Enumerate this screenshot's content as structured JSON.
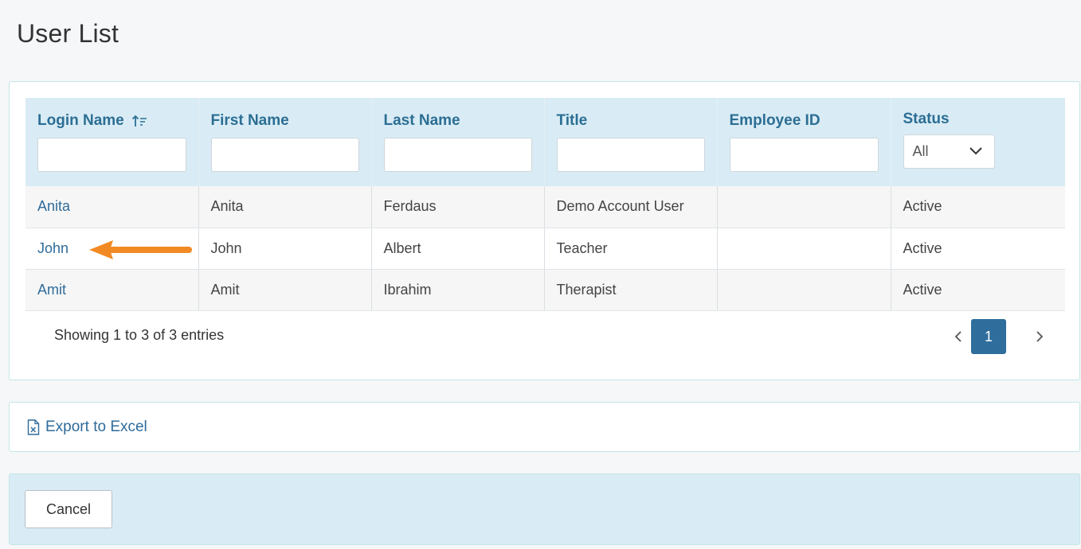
{
  "page": {
    "title": "User List"
  },
  "table": {
    "columns": [
      "Login Name",
      "First Name",
      "Last Name",
      "Title",
      "Employee ID",
      "Status"
    ],
    "status_filter": {
      "selected": "All"
    },
    "rows": [
      {
        "login": "Anita",
        "first": "Anita",
        "last": "Ferdaus",
        "title": "Demo Account User",
        "employee_id": "",
        "status": "Active"
      },
      {
        "login": "John",
        "first": "John",
        "last": "Albert",
        "title": "Teacher",
        "employee_id": "",
        "status": "Active"
      },
      {
        "login": "Amit",
        "first": "Amit",
        "last": "Ibrahim",
        "title": "Therapist",
        "employee_id": "",
        "status": "Active"
      }
    ]
  },
  "pagination": {
    "info": "Showing 1 to 3 of 3 entries",
    "current_page": "1"
  },
  "export": {
    "label": "Export to Excel"
  },
  "footer": {
    "cancel_label": "Cancel"
  },
  "colors": {
    "accent": "#2e6d9c",
    "header_bg": "#d9ecf5",
    "annotation_arrow": "#f28a24"
  },
  "icons": [
    "sort-ascending-icon",
    "chevron-down-icon",
    "chevron-left-icon",
    "chevron-right-icon",
    "excel-file-icon"
  ]
}
